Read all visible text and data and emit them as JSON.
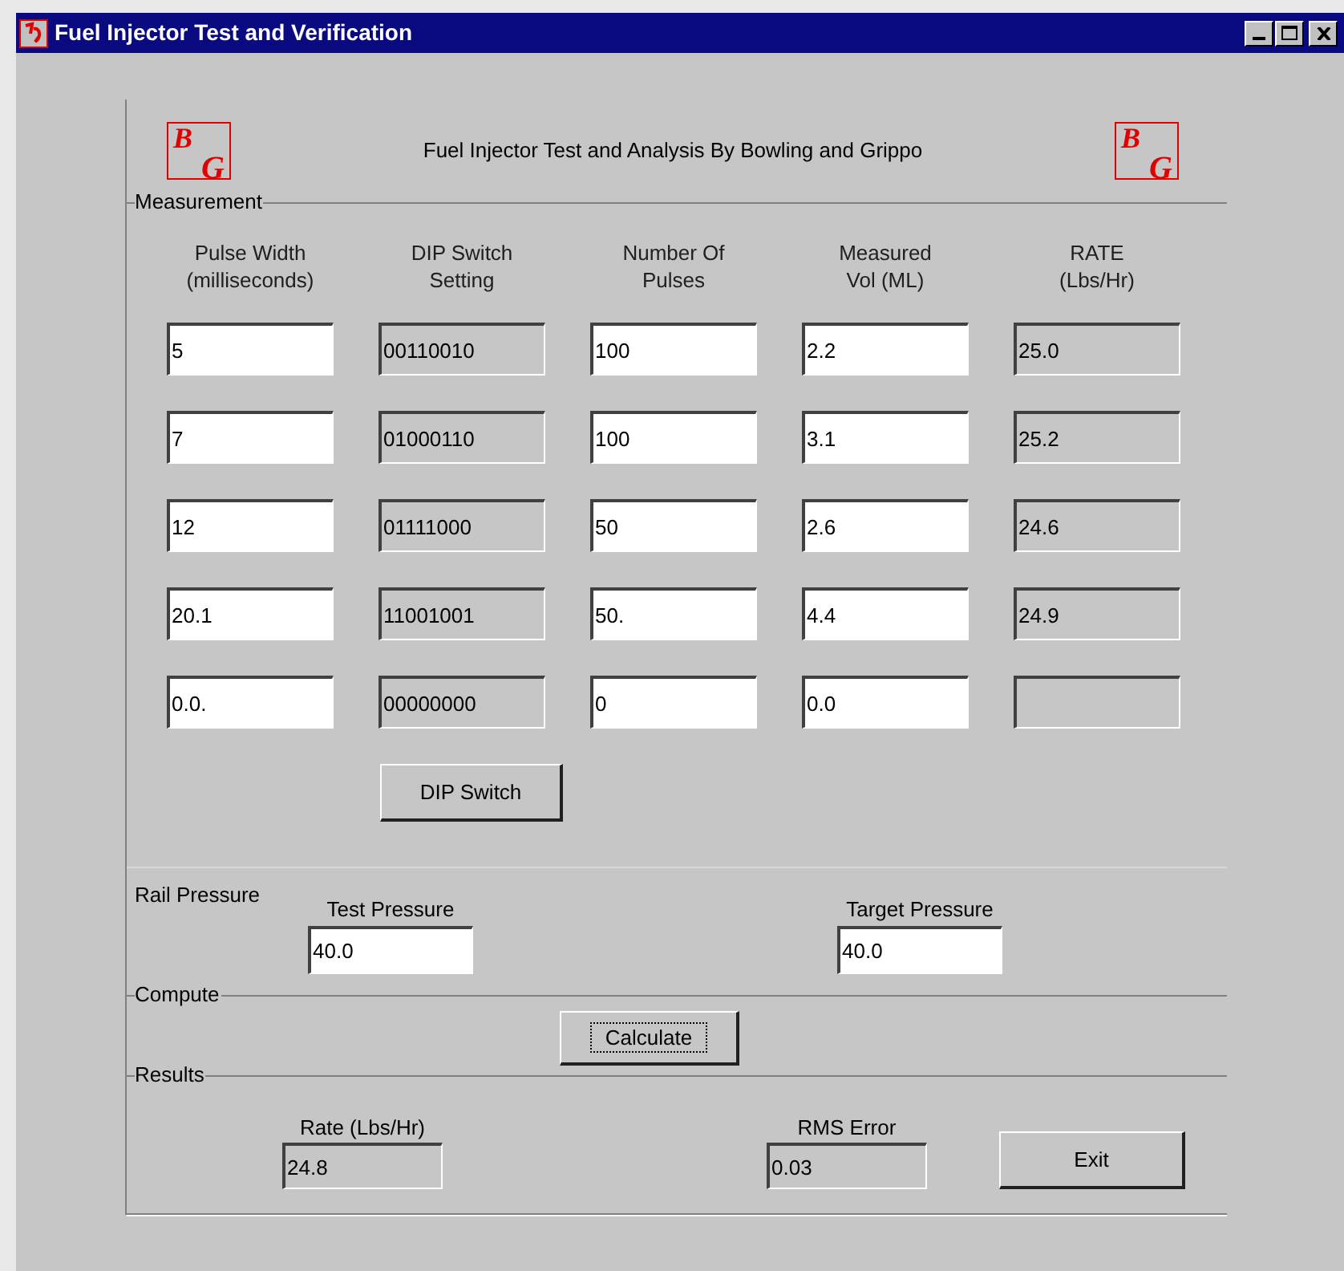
{
  "window": {
    "title": "Fuel Injector Test and Verification"
  },
  "header": {
    "title": "Fuel Injector Test and Analysis By Bowling and Grippo",
    "logos": [
      {
        "top": "B",
        "bottom": "G"
      },
      {
        "top": "B",
        "bottom": "G"
      }
    ]
  },
  "measurement": {
    "label": "Measurement",
    "columns": [
      "Pulse Width\n(milliseconds)",
      "DIP Switch\nSetting",
      "Number Of\nPulses",
      "Measured\nVol (ML)",
      "RATE\n(Lbs/Hr)"
    ],
    "rows": [
      [
        {
          "kind": "input",
          "value": "5"
        },
        {
          "kind": "readonly",
          "value": "00110010"
        },
        {
          "kind": "input",
          "value": "100"
        },
        {
          "kind": "input",
          "value": "2.2"
        },
        {
          "kind": "readonly",
          "value": "25.0"
        }
      ],
      [
        {
          "kind": "input",
          "value": "7"
        },
        {
          "kind": "readonly",
          "value": "01000110"
        },
        {
          "kind": "input",
          "value": "100"
        },
        {
          "kind": "input",
          "value": "3.1"
        },
        {
          "kind": "readonly",
          "value": "25.2"
        }
      ],
      [
        {
          "kind": "input",
          "value": "12"
        },
        {
          "kind": "readonly",
          "value": "01111000"
        },
        {
          "kind": "input",
          "value": "50"
        },
        {
          "kind": "input",
          "value": "2.6"
        },
        {
          "kind": "readonly",
          "value": "24.6"
        }
      ],
      [
        {
          "kind": "input",
          "value": "20.1"
        },
        {
          "kind": "readonly",
          "value": "11001001"
        },
        {
          "kind": "input",
          "value": "50."
        },
        {
          "kind": "input",
          "value": "4.4"
        },
        {
          "kind": "readonly",
          "value": "24.9"
        }
      ],
      [
        {
          "kind": "input",
          "value": "0.0."
        },
        {
          "kind": "readonly",
          "value": "00000000"
        },
        {
          "kind": "input",
          "value": "0"
        },
        {
          "kind": "input",
          "value": "0.0"
        },
        {
          "kind": "readonly"
        }
      ]
    ],
    "button": {
      "label": "DIP Switch",
      "focused": false
    }
  },
  "rail_pressure": {
    "label": "Rail Pressure",
    "fields": [
      {
        "label": "Test Pressure",
        "value": "40.0",
        "kind": "input"
      },
      {
        "label": "Target Pressure",
        "value": "40.0",
        "kind": "input"
      }
    ]
  },
  "compute": {
    "label": "Compute",
    "button": {
      "label": "Calculate",
      "focused": true
    }
  },
  "results": {
    "label": "Results",
    "fields": [
      {
        "label": "Rate (Lbs/Hr)",
        "value": "24.8",
        "kind": "readonly"
      },
      {
        "label": "RMS Error",
        "value": "0.03",
        "kind": "readonly"
      }
    ],
    "button": {
      "label": "Exit",
      "focused": false
    }
  }
}
